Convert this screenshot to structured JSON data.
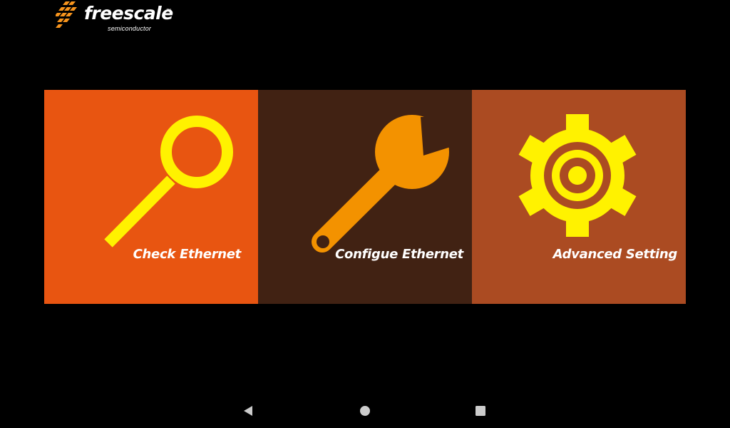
{
  "logo": {
    "wordmark": "freescale",
    "trademark": "™",
    "subtitle": "semiconductor"
  },
  "tiles": [
    {
      "label": "Check Ethernet",
      "icon": "magnifier-icon",
      "background": "#e85511",
      "icon_color": "#fff200"
    },
    {
      "label": "Configue Ethernet",
      "icon": "wrench-icon",
      "background": "#412213",
      "icon_color": "#f39200"
    },
    {
      "label": "Advanced Setting",
      "icon": "gear-icon",
      "background": "#ab4b22",
      "icon_color": "#fff200"
    }
  ],
  "navbar": {
    "buttons": [
      {
        "icon": "back-icon"
      },
      {
        "icon": "home-icon"
      },
      {
        "icon": "recents-icon"
      }
    ]
  },
  "colors": {
    "background": "#000000",
    "logo_accent": "#f7941d",
    "nav_icon": "#cccccc"
  }
}
